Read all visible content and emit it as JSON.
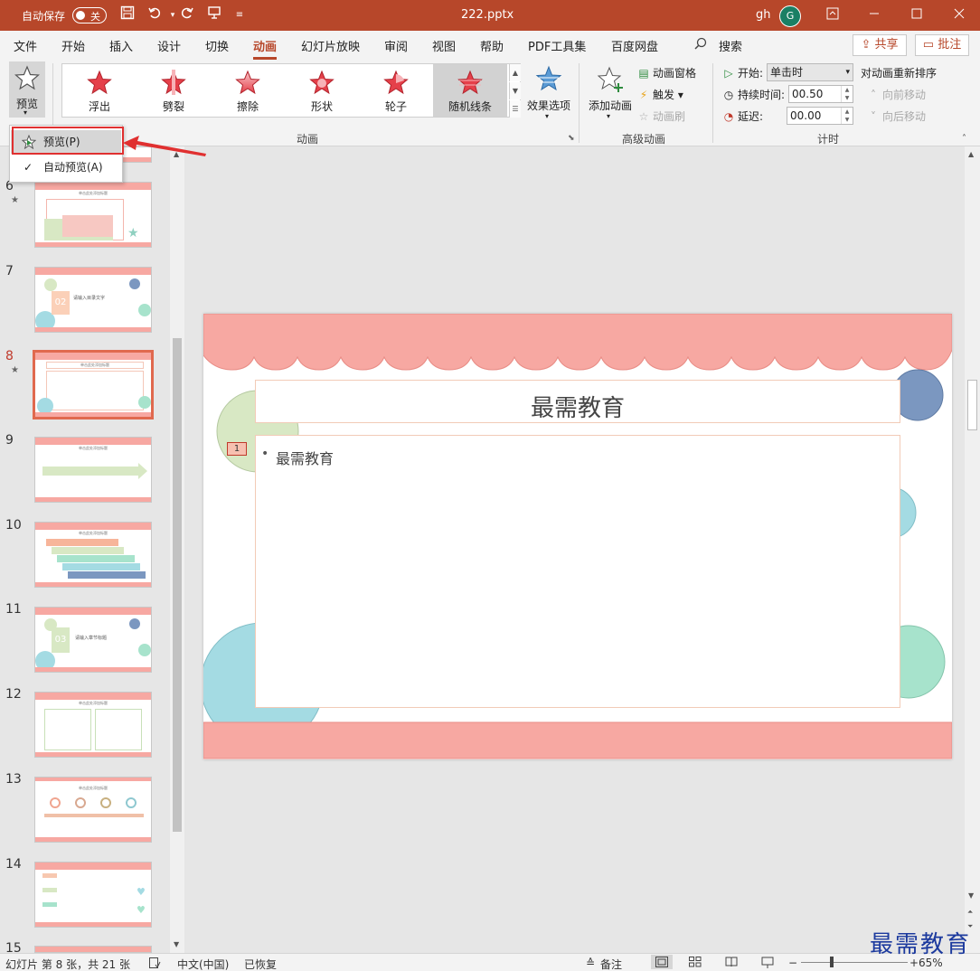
{
  "titlebar": {
    "autosave_label": "自动保存",
    "autosave_state": "关",
    "filename": "222.pptx",
    "user": "gh",
    "avatar_letter": "G"
  },
  "menu": {
    "tabs": [
      "文件",
      "开始",
      "插入",
      "设计",
      "切换",
      "动画",
      "幻灯片放映",
      "审阅",
      "视图",
      "帮助",
      "PDF工具集",
      "百度网盘"
    ],
    "active_tab": "动画",
    "search": "搜索",
    "share": "共享",
    "comment": "批注"
  },
  "ribbon": {
    "preview_label": "预览",
    "animations": [
      "浮出",
      "劈裂",
      "擦除",
      "形状",
      "轮子",
      "随机线条"
    ],
    "selected_animation": "随机线条",
    "effect_options": "效果选项",
    "group_animation": "动画",
    "add_animation": "添加动画",
    "animation_pane": "动画窗格",
    "trigger": "触发",
    "animation_painter": "动画刷",
    "group_advanced": "高级动画",
    "start_label": "开始:",
    "start_value": "单击时",
    "duration_label": "持续时间:",
    "duration_value": "00.50",
    "delay_label": "延迟:",
    "delay_value": "00.00",
    "reorder_title": "对动画重新排序",
    "move_earlier": "向前移动",
    "move_later": "向后移动",
    "group_timing": "计时"
  },
  "preview_menu": {
    "items": [
      "预览(P)",
      "自动预览(A)"
    ],
    "checked": "自动预览(A)"
  },
  "thumbnails": [
    {
      "num": "6",
      "star": true,
      "title": "单击此处添加标题"
    },
    {
      "num": "7",
      "star": false,
      "title": "请输入目录文字"
    },
    {
      "num": "8",
      "star": true,
      "title": "单击此处添加标题",
      "selected": true
    },
    {
      "num": "9",
      "star": false,
      "title": "单击此处添加标题"
    },
    {
      "num": "10",
      "star": false,
      "title": "单击此处添加标题"
    },
    {
      "num": "11",
      "star": false,
      "title": "请输入章节标题"
    },
    {
      "num": "12",
      "star": false,
      "title": "单击此处添加标题"
    },
    {
      "num": "13",
      "star": false,
      "title": "单击此处添加标题"
    },
    {
      "num": "14",
      "star": false,
      "title": ""
    },
    {
      "num": "15",
      "star": false,
      "title": ""
    }
  ],
  "slide": {
    "title": "最需教育",
    "bullet": "最需教育",
    "anim_tag": "1"
  },
  "status": {
    "slide_info": "幻灯片 第 8 张，共 21 张",
    "language": "中文(中国)",
    "recovered": "已恢复",
    "notes": "备注",
    "zoom": "65%"
  },
  "watermark": "最需教育",
  "colors": {
    "accent": "#b7472a",
    "scallop": "#f7a8a2",
    "circle_green": "#d8e8c4",
    "circle_blue": "#a4dbe3",
    "circle_navy": "#7b97c0",
    "circle_mint": "#a7e3cc"
  }
}
